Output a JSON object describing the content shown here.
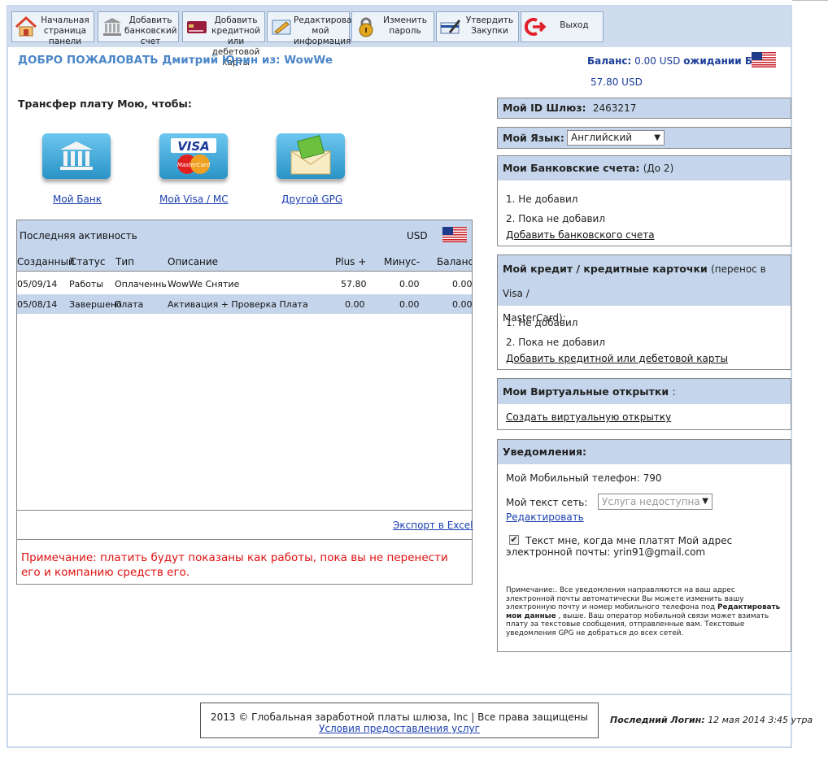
{
  "nav": [
    {
      "label": "Начальная страница панели",
      "icon": "home-icon"
    },
    {
      "label": "Добавить банковский счет",
      "icon": "bank-icon"
    },
    {
      "label": "Добавить кредитной или дебетовой карты",
      "icon": "credit-card-icon"
    },
    {
      "label": "Редактировать мой информация",
      "icon": "edit-icon"
    },
    {
      "label": "Изменить пароль",
      "icon": "lock-icon"
    },
    {
      "label": "Утвердить Закупки",
      "icon": "approve-icon"
    },
    {
      "label": "Выход",
      "icon": "logout-icon"
    }
  ],
  "welcome": "ДОБРО ПОЖАЛОВАТЬ Дмитрий Юрин из:  WowWe",
  "balance": {
    "label": "Баланс:",
    "value": "0.00 USD",
    "pending_label": "ожидании Бал",
    "pending_value": "57.80 USD"
  },
  "transfer": {
    "title": "Трансфер плату Мою, чтобы:",
    "options": [
      {
        "label": "Мой Банк",
        "icon": "bank-tile-icon"
      },
      {
        "label": "Мой Visa / MC",
        "icon": "visa-mastercard-icon"
      },
      {
        "label": "Другой GPG",
        "icon": "envelope-money-icon"
      }
    ]
  },
  "activity": {
    "title": "Последняя активность",
    "currency": "USD",
    "columns": [
      "Созданный",
      "Статус",
      "Тип",
      "Описание",
      "Plus +",
      "Минус-",
      "Баланс"
    ],
    "rows": [
      [
        "05/09/14",
        "Работы",
        "Оплаченный",
        "WowWe Снятие",
        "57.80",
        "0.00",
        "0.00"
      ],
      [
        "05/08/14",
        "Завершено",
        "Плата",
        "Активация + Проверка Плата",
        "0.00",
        "0.00",
        "0.00"
      ]
    ],
    "export_label": "Экспорт в Excel",
    "note": "Примечание: платить будут показаны как работы, пока вы не перенести его и компанию средств его."
  },
  "gateway": {
    "label": "Мой ID Шлюз:",
    "value": "2463217"
  },
  "language": {
    "label": "Мой Язык:",
    "selected": "Английский"
  },
  "bank_accounts": {
    "title": "Мои Банковские счета:",
    "limit": "(До 2)",
    "items": [
      "1.  Не добавил",
      "2.  Пока не добавил"
    ],
    "add_label": "Добавить банковского счета"
  },
  "cards": {
    "title": "Мой кредит / кредитные карточки",
    "subtitle_a": "(перенос в Visa /",
    "subtitle_b": "MasterCard):",
    "items": [
      "1.  Не добавил",
      "2.  Пока не добавил"
    ],
    "add_label": "Добавить кредитной или дебетовой карты"
  },
  "virtual_cards": {
    "title": "Мои Виртуальные открытки",
    "suffix": ":",
    "create_label": "Создать виртуальную открытку"
  },
  "notifications": {
    "title": "Уведомления:",
    "mobile_label": "Мой Мобильный телефон:",
    "mobile_value": "790",
    "network_label": "Мой текст сеть:",
    "network_selected": "Услуга недоступна",
    "edit_label": "Редактировать",
    "checkbox_text": "Текст мне, когда мне платят Мой адрес электронной почты: yrin91@gmail.com",
    "fine_print_a": "Примечание:. Все уведомления направляются на ваш адрес электронной почты автоматически Вы можете изменить вашу электронную почту и номер мобильного телефона под",
    "fine_print_bold": "Редактировать мои данные",
    "fine_print_b": ", выше. Ваш оператор мобильной связи может взимать плату за текстовые сообщения, отправленные вам. Текстовые уведомления GPG не добраться до всех сетей."
  },
  "footer": {
    "copyright": "2013 © Глобальная заработной платы шлюза, Inc | Все права защищены",
    "terms_label": "Условия предоставления услуг",
    "last_login_label": "Последний Логин:",
    "last_login_value": "12 мая 2014 3:45 утра"
  }
}
